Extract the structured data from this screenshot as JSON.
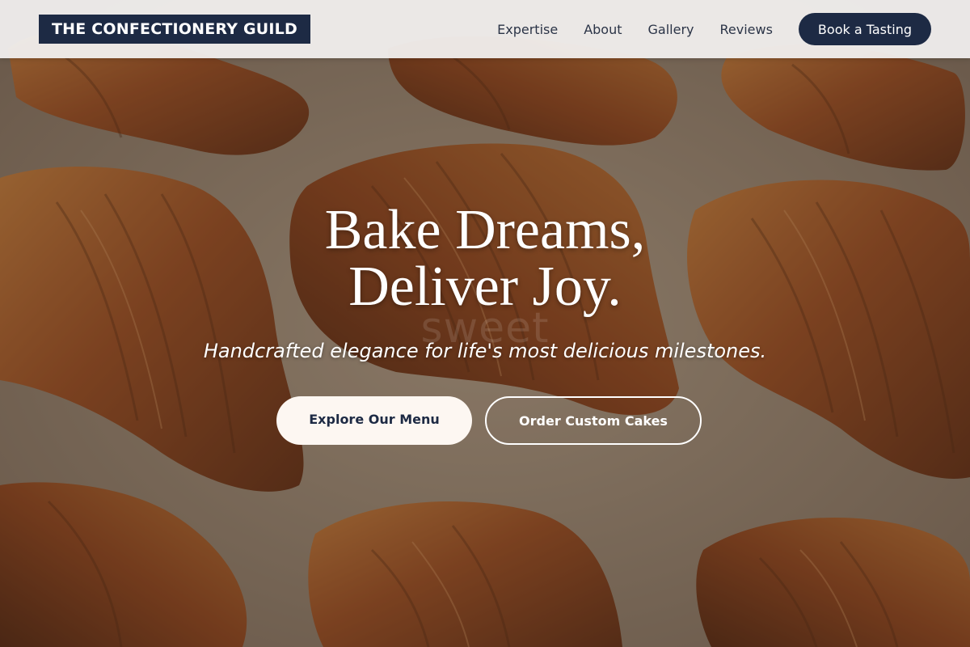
{
  "header": {
    "logo": "THE CONFECTIONERY GUILD",
    "nav": [
      {
        "label": "Expertise"
      },
      {
        "label": "About"
      },
      {
        "label": "Gallery"
      },
      {
        "label": "Reviews"
      }
    ],
    "cta_label": "Book a Tasting"
  },
  "hero": {
    "headline_line1": "Bake Dreams,",
    "headline_line2": "Deliver Joy.",
    "watermark": "sweet",
    "tagline": "Handcrafted elegance for life's most delicious milestones.",
    "primary_button": "Explore Our Menu",
    "secondary_button": "Order Custom Cakes",
    "background_image": "croissants-on-baking-paper"
  },
  "colors": {
    "navy": "#1d2a44",
    "header_bg": "#f1efee",
    "cream": "#fdf7f2",
    "croissant": "#b8652a"
  }
}
